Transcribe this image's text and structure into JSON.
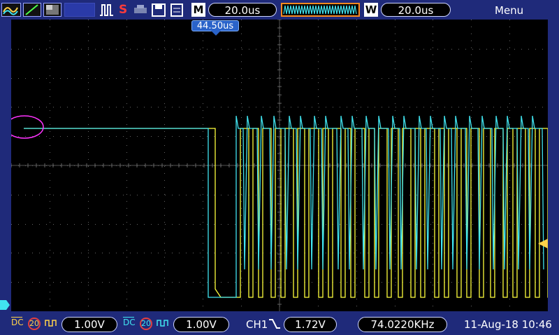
{
  "toolbar": {
    "horizontal_mode_label": "M",
    "horizontal_time": "20.0us",
    "window_mode_label": "W",
    "window_time": "20.0us",
    "menu_label": "Menu",
    "run_stop_label": "S"
  },
  "trigger_position": "44.50us",
  "channels": [
    {
      "name": "CH1",
      "color": "#ffff3c",
      "coupling": "DC",
      "bw_limit": "20",
      "scale": "1.00V"
    },
    {
      "name": "CH2",
      "color": "#41e4f0",
      "coupling": "DC",
      "bw_limit": "20",
      "scale": "1.00V"
    }
  ],
  "trigger": {
    "source": "CH1",
    "slope": "falling",
    "level": "1.72V"
  },
  "frequency": "74.0220KHz",
  "datetime": "11-Aug-18 10:46",
  "icons": [
    "waveform-mode-icon",
    "ramp-icon",
    "grayscale-icon",
    "run-stop-icon",
    "printer-icon",
    "save-icon",
    "memory-icon"
  ],
  "colors": {
    "ch1": "#ffff3c",
    "ch2": "#41e4f0",
    "annotation": "#ff33ff",
    "background": "#1f2a7a"
  }
}
